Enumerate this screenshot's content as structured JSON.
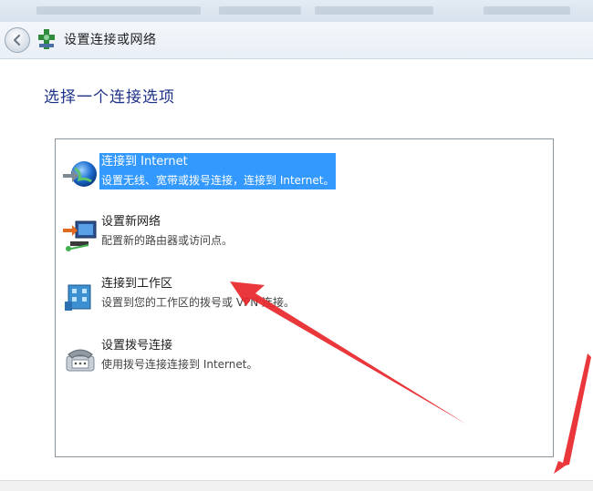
{
  "window": {
    "title": "设置连接或网络"
  },
  "nav": {
    "back_icon": "back-arrow-icon",
    "wizard_icon": "network-wizard-icon"
  },
  "page": {
    "heading": "选择一个连接选项"
  },
  "options": [
    {
      "title": "连接到 Internet",
      "description": "设置无线、宽带或拨号连接，连接到 Internet。",
      "icon": "globe-connect-icon",
      "selected": true
    },
    {
      "title": "设置新网络",
      "description": "配置新的路由器或访问点。",
      "icon": "new-network-icon",
      "selected": false
    },
    {
      "title": "连接到工作区",
      "description": "设置到您的工作区的拨号或 VPN 连接。",
      "icon": "workplace-icon",
      "selected": false
    },
    {
      "title": "设置拨号连接",
      "description": "使用拨号连接连接到 Internet。",
      "icon": "dialup-phone-icon",
      "selected": false
    }
  ],
  "colors": {
    "selection": "#3399ff",
    "heading": "#1e3287",
    "annotation_arrow": "#e8262a"
  }
}
